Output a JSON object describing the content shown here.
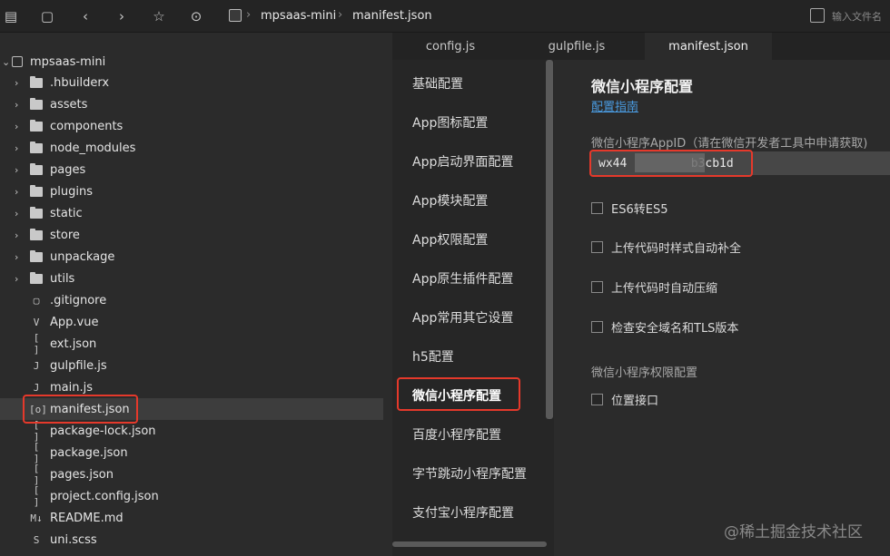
{
  "toolbar": {
    "icons": [
      "new-file-icon",
      "save-icon",
      "back-icon",
      "forward-icon",
      "star-icon",
      "run-icon"
    ],
    "breadcrumb": [
      "mpsaas-mini",
      "manifest.json"
    ],
    "search_placeholder": "输入文件名"
  },
  "sidebar": {
    "root": "mpsaas-mini",
    "folders": [
      ".hbuilderx",
      "assets",
      "components",
      "node_modules",
      "pages",
      "plugins",
      "static",
      "store",
      "unpackage",
      "utils"
    ],
    "files": [
      {
        "name": ".gitignore",
        "icon": "▢"
      },
      {
        "name": "App.vue",
        "icon": "V"
      },
      {
        "name": "ext.json",
        "icon": "[ ]"
      },
      {
        "name": "gulpfile.js",
        "icon": "J"
      },
      {
        "name": "main.js",
        "icon": "J"
      },
      {
        "name": "manifest.json",
        "icon": "[o]"
      },
      {
        "name": "package-lock.json",
        "icon": "[ ]"
      },
      {
        "name": "package.json",
        "icon": "[ ]"
      },
      {
        "name": "pages.json",
        "icon": "[ ]"
      },
      {
        "name": "project.config.json",
        "icon": "[ ]"
      },
      {
        "name": "README.md",
        "icon": "M↓"
      },
      {
        "name": "uni.scss",
        "icon": "S"
      }
    ],
    "selected": "manifest.json"
  },
  "tabs": [
    "config.js",
    "gulpfile.js",
    "manifest.json"
  ],
  "active_tab": "manifest.json",
  "config_nav": [
    "基础配置",
    "App图标配置",
    "App启动界面配置",
    "App模块配置",
    "App权限配置",
    "App原生插件配置",
    "App常用其它设置",
    "h5配置",
    "微信小程序配置",
    "百度小程序配置",
    "字节跳动小程序配置",
    "支付宝小程序配置"
  ],
  "config_nav_active": "微信小程序配置",
  "content": {
    "title": "微信小程序配置",
    "guide_link": "配置指南",
    "appid_label": "微信小程序AppID（请在微信开发者工具中申请获取)",
    "appid_value": "wx44         b3cb1d",
    "options": [
      "ES6转ES5",
      "上传代码时样式自动补全",
      "上传代码时自动压缩",
      "检查安全域名和TLS版本"
    ],
    "permissions_label": "微信小程序权限配置",
    "permissions": [
      "位置接口"
    ]
  },
  "watermark": "@稀土掘金技术社区",
  "colors": {
    "highlight": "#e5392b",
    "link": "#4a9be0",
    "background": "#2b2b2b"
  }
}
